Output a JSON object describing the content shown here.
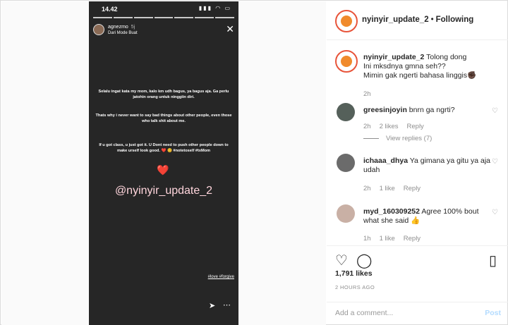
{
  "story": {
    "clock": "14.42",
    "user": "agnezmo",
    "time": "5j",
    "subtitle": "Dari Mode Buat",
    "paragraph1": "Selalu ingat kata my mom, kalo km udh bagus, ya bagus aja. Ga perlu jatohin orang untuk ninggiin diri.",
    "paragraph2": "Thats why i never want to say bad things about other people, even those who talk shit about me.",
    "paragraph3": "If u got class, u just got it. U Dont need to push other people down to make urself look good. ❤️ 😊 #notetoself #txMom",
    "heart": "❤️",
    "mention": "@nyinyir_update_2",
    "tags": "#love #forgive",
    "icons": [
      "signal-icon",
      "wifi-icon",
      "battery-icon",
      "close-icon",
      "send-icon",
      "more-icon"
    ]
  },
  "header": {
    "username": "nyinyir_update_2",
    "separator": "•",
    "follow": "Following"
  },
  "comments": [
    {
      "user": "nyinyir_update_2",
      "text": "Tolong dong\nIni mksdnya gmna seh??\nMimin gak ngerti bahasa linggis✊🏿",
      "time": "2h"
    },
    {
      "user": "greesinjoyin",
      "text": "bnrn ga ngrti?",
      "time": "2h",
      "likes": "2 likes",
      "reply": "Reply",
      "view_replies": "View replies (7)"
    },
    {
      "user": "ichaaa_dhya",
      "text": "Ya gimana ya gitu ya aja udah",
      "time": "2h",
      "likes": "1 like",
      "reply": "Reply"
    },
    {
      "user": "myd_160309252",
      "text": "Agree 100% bout what she said 👍",
      "time": "1h",
      "likes": "1 like",
      "reply": "Reply"
    }
  ],
  "actions": {
    "likes": "1,791 likes",
    "ago": "2 HOURS AGO",
    "icons": [
      "heart-icon",
      "comment-icon",
      "bookmark-icon"
    ]
  },
  "add_comment": {
    "placeholder": "Add a comment...",
    "post": "Post"
  },
  "colors": {
    "story_bg": "#262626",
    "accent_post": "#b3dbff",
    "meta": "#8e8e8e",
    "avatar_ring": "#e8543a"
  }
}
